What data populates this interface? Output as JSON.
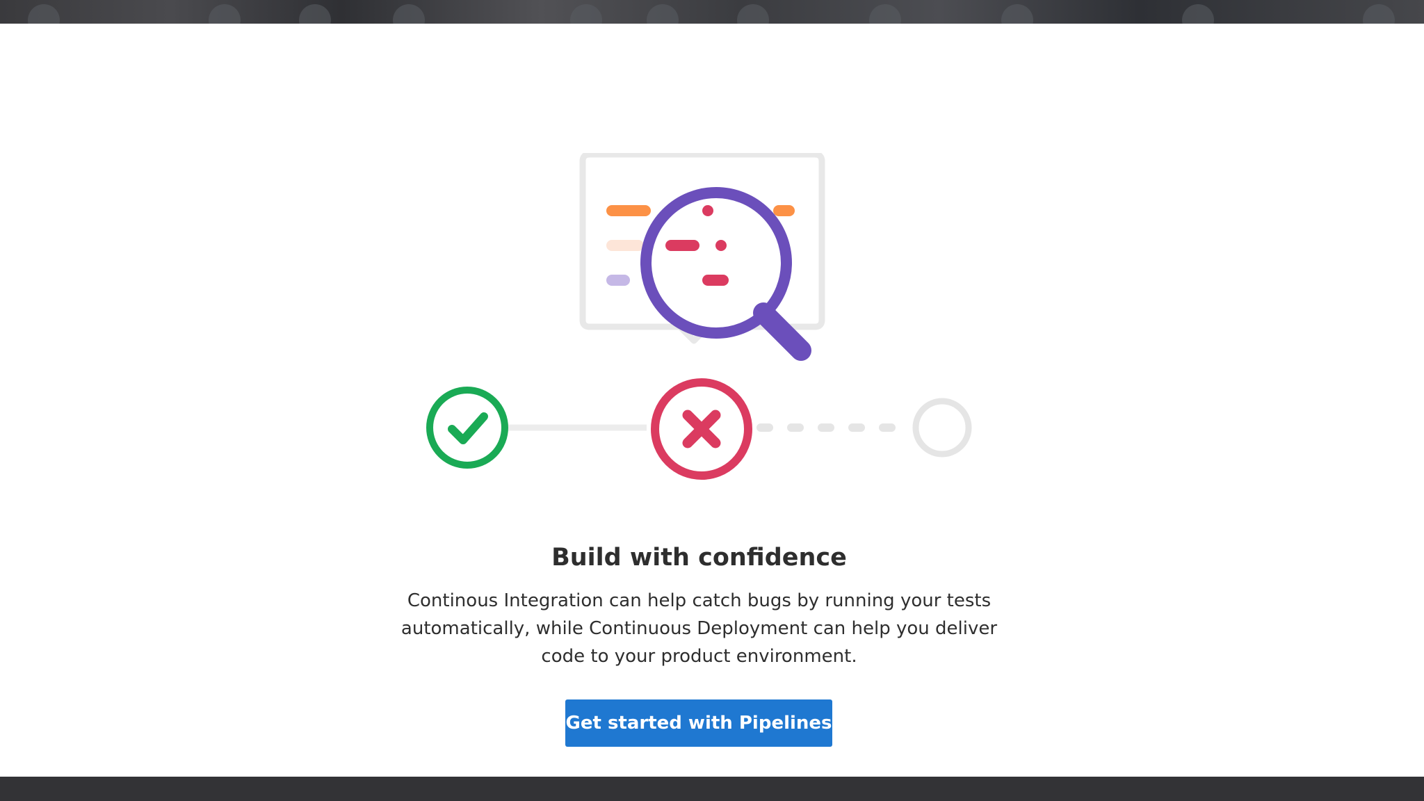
{
  "empty_state": {
    "title": "Build with confidence",
    "description": "Continous Integration can help catch bugs by running your tests automatically, while Continuous Deployment can help you deliver code to your product environment.",
    "cta_label": "Get started with Pipelines"
  },
  "illustration": {
    "icons": [
      "magnifying-glass-icon",
      "speech-bubble-icon",
      "check-circle-icon",
      "x-circle-icon",
      "empty-circle-icon"
    ]
  },
  "colors": {
    "primary": "#1f78d1",
    "success": "#1aaa55",
    "failed": "#db3b60",
    "lens": "#6b4fbb",
    "orange": "#fc9146",
    "muted": "#e5e5e5"
  }
}
